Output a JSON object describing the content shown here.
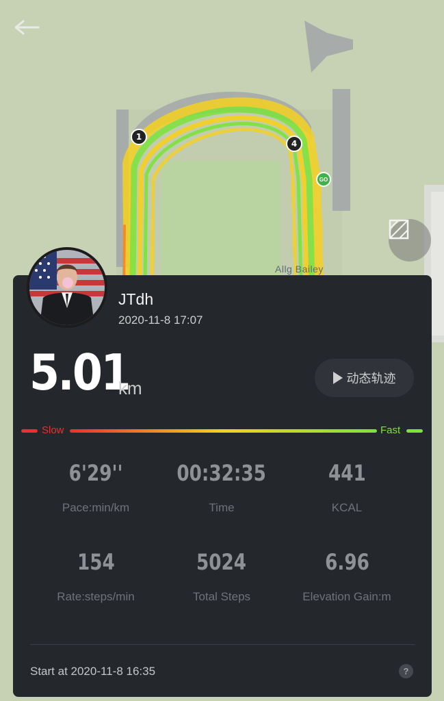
{
  "map": {
    "place_label": "Allg  Bailey",
    "markers": [
      "1",
      "4"
    ],
    "go_label": "GO"
  },
  "user": {
    "name": "JTdh",
    "datetime": "2020-11-8 17:07"
  },
  "workout": {
    "distance": "5.01",
    "distance_unit": "km",
    "replay_label": "动态轨迹"
  },
  "speed_legend": {
    "slow": "Slow",
    "fast": "Fast",
    "colors": {
      "slow": "#e8322c",
      "mid": "#f5d020",
      "fast": "#7be33b"
    }
  },
  "stats": [
    {
      "value": "6'29''",
      "label": "Pace:min/km"
    },
    {
      "value": "00:32:35",
      "label": "Time"
    },
    {
      "value": "441",
      "label": "KCAL"
    },
    {
      "value": "154",
      "label": "Rate:steps/min"
    },
    {
      "value": "5024",
      "label": "Total Steps"
    },
    {
      "value": "6.96",
      "label": "Elevation Gain:m"
    }
  ],
  "footer": {
    "start": "Start at 2020-11-8 16:35",
    "help": "?"
  },
  "icons": {
    "back": "back-arrow-icon",
    "layers": "map-layer-icon",
    "help": "help-icon"
  }
}
